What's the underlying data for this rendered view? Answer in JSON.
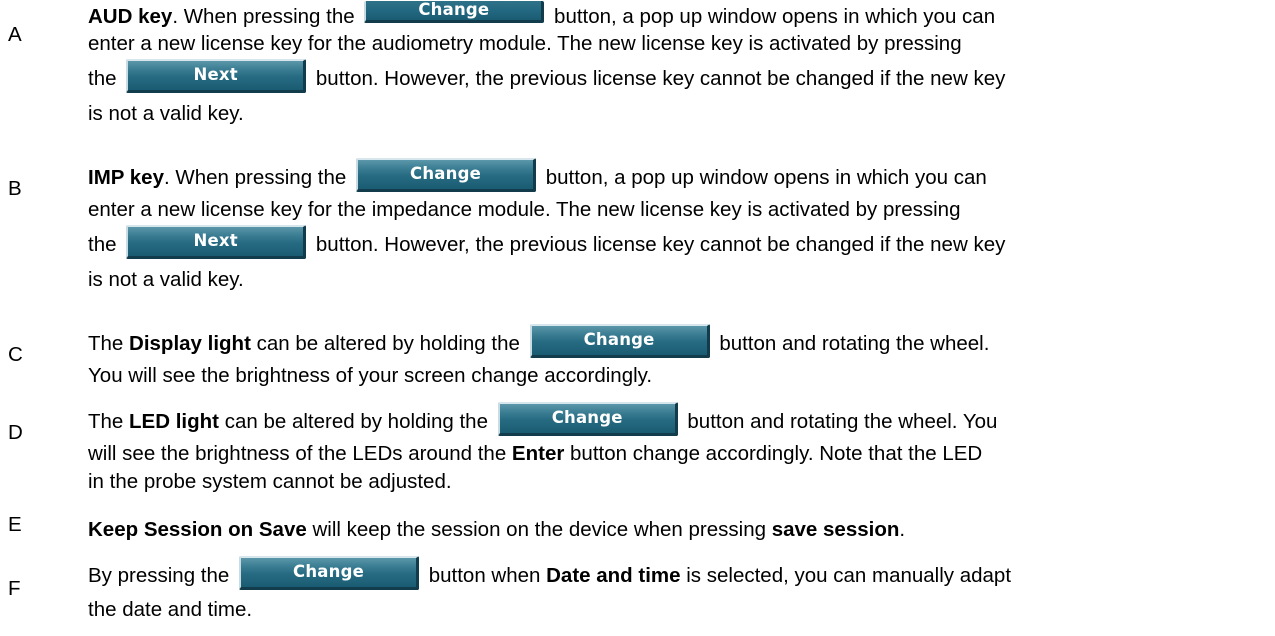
{
  "items": {
    "a": {
      "letter": "A",
      "l1_bold": "AUD key",
      "l1_t1": ". When pressing the",
      "l1_t2": "button, a pop up window opens in which you can",
      "l2": "enter a new license key for the audiometry module. The new license key is activated by pressing",
      "l3_t1": "the",
      "l3_t2": "button. However, the previous license key cannot be changed if the new key",
      "l4": "is not a valid key."
    },
    "b": {
      "letter": "B",
      "l1_bold": "IMP key",
      "l1_t1": ". When pressing the",
      "l1_t2": "button, a pop up window opens in which you can",
      "l2": "enter a new license key for the impedance module.  The new license key is activated by pressing",
      "l3_t1": "the",
      "l3_t2": "button. However, the previous license key cannot be changed if the new key",
      "l4": "is not a valid key."
    },
    "c": {
      "letter": "C",
      "l1_t0": "The",
      "l1_bold": "Display light",
      "l1_t1": "can be altered by holding the",
      "l1_t2": "button and rotating the wheel.",
      "l2": "You will see the brightness of your screen change accordingly."
    },
    "d": {
      "letter": "D",
      "l1_t0": "The",
      "l1_bold": "LED light",
      "l1_t1": "can be altered by holding the",
      "l1_t2": "button and rotating the wheel. You",
      "l2_t1": "will see the brightness of the LEDs around the",
      "l2_bold": "Enter",
      "l2_t2": "button change accordingly. Note that the LED",
      "l3": "in the probe system cannot be adjusted."
    },
    "e": {
      "letter": "E",
      "l1_bold1": "Keep Session on Save",
      "l1_t1": "will keep the session on the device when pressing",
      "l1_bold2": "save session",
      "l1_t2": "."
    },
    "f": {
      "letter": "F",
      "l1_t1": "By pressing the",
      "l1_t2": "button when",
      "l1_bold": "Date and time",
      "l1_t3": "is selected, you can manually adapt",
      "l2": "the date and time."
    }
  },
  "buttons": {
    "change_label": "Change",
    "next_label": "Next"
  },
  "colors": {
    "button_face": "#266b82",
    "button_text": "#ffffff",
    "body_text": "#000000"
  }
}
